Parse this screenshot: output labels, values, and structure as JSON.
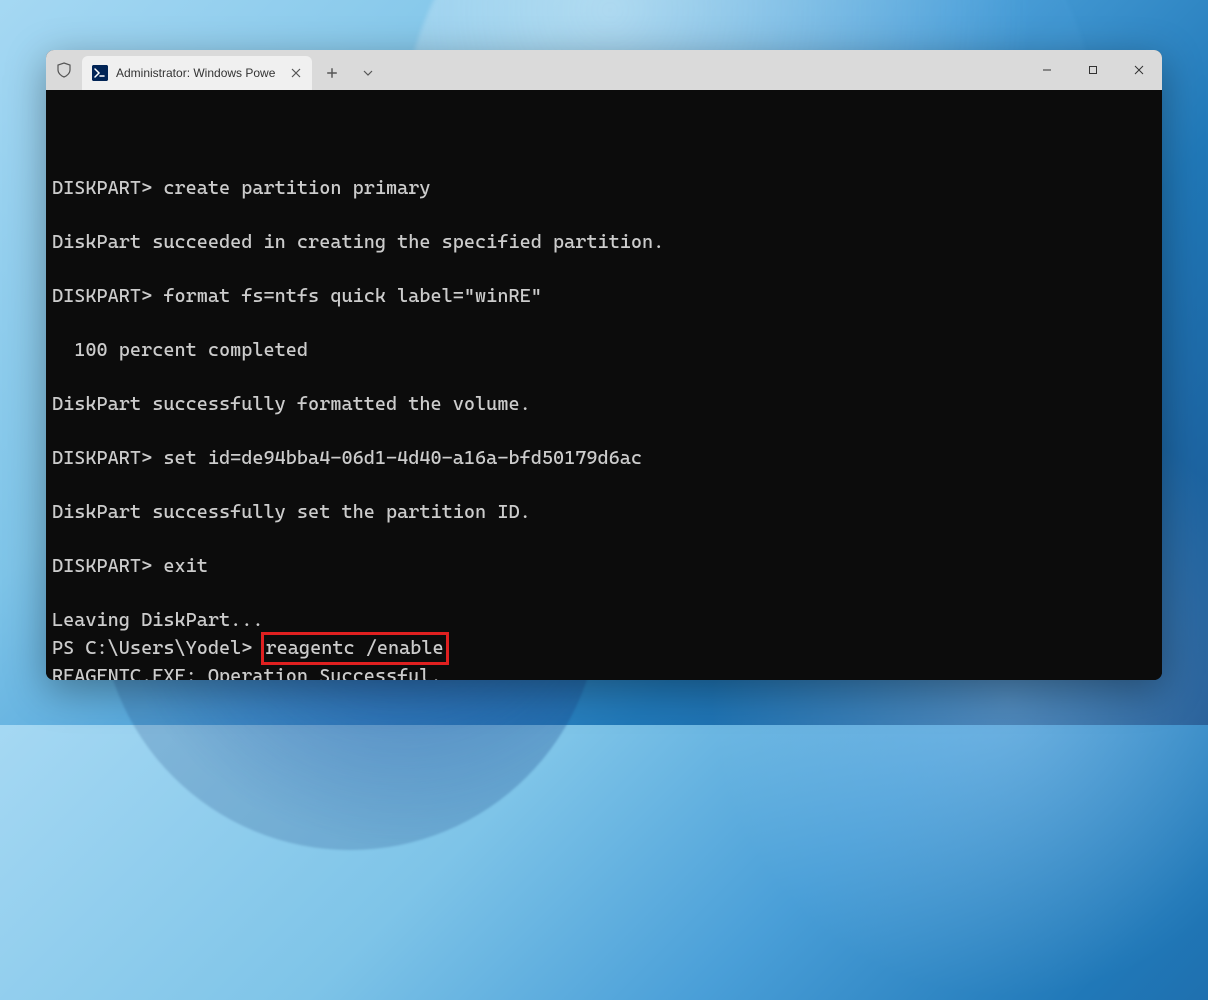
{
  "tab": {
    "title": "Administrator: Windows Powe",
    "icon_label": ">_"
  },
  "terminal": {
    "lines": [
      {
        "text": "DISKPART> create partition primary"
      },
      {
        "text": ""
      },
      {
        "text": "DiskPart succeeded in creating the specified partition."
      },
      {
        "text": ""
      },
      {
        "text": "DISKPART> format fs=ntfs quick label=\"winRE\""
      },
      {
        "text": ""
      },
      {
        "text": "  100 percent completed"
      },
      {
        "text": ""
      },
      {
        "text": "DiskPart successfully formatted the volume."
      },
      {
        "text": ""
      },
      {
        "text": "DISKPART> set id=de94bba4-06d1-4d40-a16a-bfd50179d6ac"
      },
      {
        "text": ""
      },
      {
        "text": "DiskPart successfully set the partition ID."
      },
      {
        "text": ""
      },
      {
        "text": "DISKPART> exit"
      },
      {
        "text": ""
      },
      {
        "text": "Leaving DiskPart..."
      }
    ],
    "highlighted_line": {
      "prefix": "PS C:\\Users\\Yodel> ",
      "highlighted": "reagentc /enable"
    },
    "after_highlight": [
      {
        "text": "REAGENTC.EXE: Operation Successful."
      },
      {
        "text": ""
      }
    ],
    "prompt": "PS C:\\Users\\Yodel> "
  },
  "highlight_color": "#e02020"
}
